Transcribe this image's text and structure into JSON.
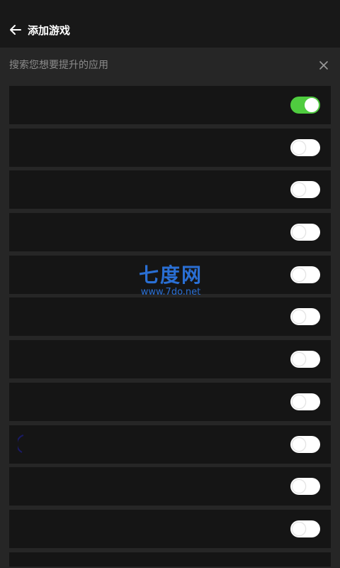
{
  "header": {
    "title": "添加游戏"
  },
  "search": {
    "placeholder": "搜索您想要提升的应用"
  },
  "apps": [
    {
      "toggle": "on"
    },
    {
      "toggle": "off"
    },
    {
      "toggle": "off"
    },
    {
      "toggle": "off"
    },
    {
      "toggle": "off"
    },
    {
      "toggle": "off"
    },
    {
      "toggle": "off"
    },
    {
      "toggle": "off"
    },
    {
      "toggle": "off"
    },
    {
      "toggle": "off"
    },
    {
      "toggle": "off"
    }
  ],
  "watermark": {
    "brand": "七度网",
    "url": "www.7do.net"
  },
  "colors": {
    "toggle_on": "#4fcc3f",
    "watermark": "#2a6fd4"
  },
  "icons": [
    "arrow-left-icon",
    "close-icon"
  ]
}
